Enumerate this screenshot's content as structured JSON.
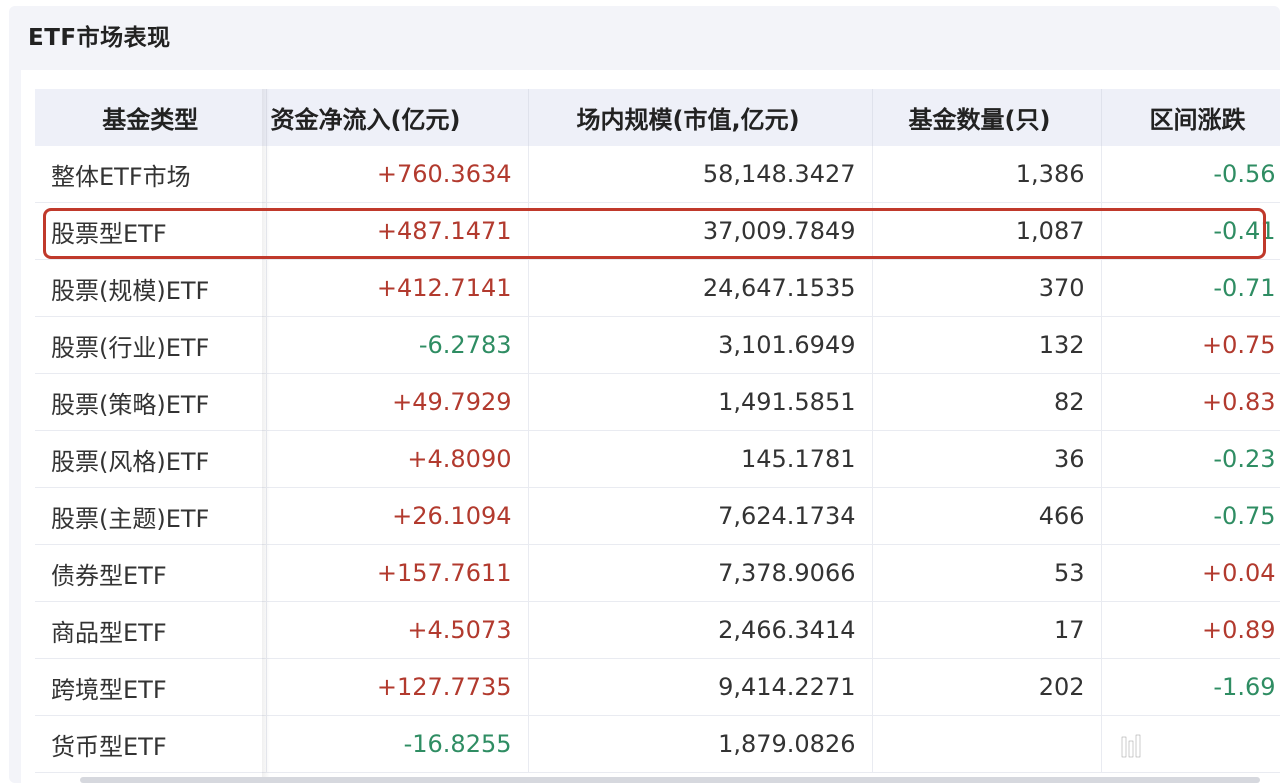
{
  "title": "ETF市场表现",
  "table": {
    "headers": [
      "基金类型",
      "资金净流入(亿元)",
      "场内规模(市值,亿元)",
      "基金数量(只)",
      "区间涨跌"
    ],
    "rows": [
      {
        "name": "整体ETF市场",
        "flow": "+760.3634",
        "flow_dir": "up",
        "scale": "58,148.3427",
        "count": "1,386",
        "chg": "-0.56",
        "chg_dir": "down"
      },
      {
        "name": "股票型ETF",
        "flow": "+487.1471",
        "flow_dir": "up",
        "scale": "37,009.7849",
        "count": "1,087",
        "chg": "-0.41",
        "chg_dir": "down",
        "highlighted": true
      },
      {
        "name": "股票(规模)ETF",
        "flow": "+412.7141",
        "flow_dir": "up",
        "scale": "24,647.1535",
        "count": "370",
        "chg": "-0.71",
        "chg_dir": "down"
      },
      {
        "name": "股票(行业)ETF",
        "flow": "-6.2783",
        "flow_dir": "down",
        "scale": "3,101.6949",
        "count": "132",
        "chg": "+0.75",
        "chg_dir": "up"
      },
      {
        "name": "股票(策略)ETF",
        "flow": "+49.7929",
        "flow_dir": "up",
        "scale": "1,491.5851",
        "count": "82",
        "chg": "+0.83",
        "chg_dir": "up"
      },
      {
        "name": "股票(风格)ETF",
        "flow": "+4.8090",
        "flow_dir": "up",
        "scale": "145.1781",
        "count": "36",
        "chg": "-0.23",
        "chg_dir": "down"
      },
      {
        "name": "股票(主题)ETF",
        "flow": "+26.1094",
        "flow_dir": "up",
        "scale": "7,624.1734",
        "count": "466",
        "chg": "-0.75",
        "chg_dir": "down"
      },
      {
        "name": "债券型ETF",
        "flow": "+157.7611",
        "flow_dir": "up",
        "scale": "7,378.9066",
        "count": "53",
        "chg": "+0.04",
        "chg_dir": "up"
      },
      {
        "name": "商品型ETF",
        "flow": "+4.5073",
        "flow_dir": "up",
        "scale": "2,466.3414",
        "count": "17",
        "chg": "+0.89",
        "chg_dir": "up"
      },
      {
        "name": "跨境型ETF",
        "flow": "+127.7735",
        "flow_dir": "up",
        "scale": "9,414.2271",
        "count": "202",
        "chg": "-1.69",
        "chg_dir": "down"
      },
      {
        "name": "货币型ETF",
        "flow": "-16.8255",
        "flow_dir": "down",
        "scale": "1,879.0826",
        "count": "",
        "chg": "",
        "chg_dir": "up"
      }
    ]
  },
  "colors": {
    "up": "#b23a2e",
    "down": "#2f8d63",
    "highlight": "#c0392b",
    "header_bg": "#eef0f8"
  },
  "watermark_icon": "brand-logo-icon"
}
